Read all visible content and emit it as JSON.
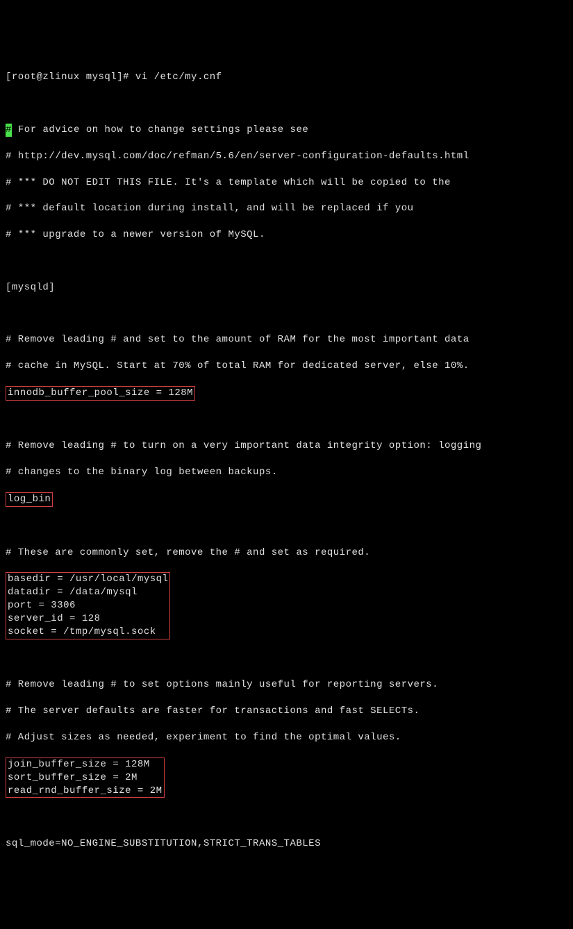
{
  "prompt": "[root@zlinux mysql]# vi /etc/my.cnf",
  "cursor_char": "#",
  "first_line_rest": " For advice on how to change settings please see",
  "comment_url": "# http://dev.mysql.com/doc/refman/5.6/en/server-configuration-defaults.html",
  "comment_edit1": "# *** DO NOT EDIT THIS FILE. It's a template which will be copied to the",
  "comment_edit2": "# *** default location during install, and will be replaced if you",
  "comment_edit3": "# *** upgrade to a newer version of MySQL.",
  "section_mysqld": "[mysqld]",
  "comment_ram1": "# Remove leading # and set to the amount of RAM for the most important data",
  "comment_ram2": "# cache in MySQL. Start at 70% of total RAM for dedicated server, else 10%.",
  "innodb_line": "innodb_buffer_pool_size = 128M",
  "comment_log1": "# Remove leading # to turn on a very important data integrity option: logging",
  "comment_log2": "# changes to the binary log between backups.",
  "log_bin_line": "log_bin",
  "comment_common": "# These are commonly set, remove the # and set as required.",
  "basedir_line": "basedir = /usr/local/mysql",
  "datadir_line": "datadir = /data/mysql",
  "port_line": "port = 3306",
  "server_id_line": "server_id = 128",
  "socket_line": "socket = /tmp/mysql.sock",
  "comment_report1": "# Remove leading # to set options mainly useful for reporting servers.",
  "comment_report2": "# The server defaults are faster for transactions and fast SELECTs.",
  "comment_report3": "# Adjust sizes as needed, experiment to find the optimal values.",
  "join_buffer_line": "join_buffer_size = 128M",
  "sort_buffer_line": "sort_buffer_size = 2M",
  "read_rnd_line": "read_rnd_buffer_size = 2M",
  "sql_mode_line": "sql_mode=NO_ENGINE_SUBSTITUTION,STRICT_TRANS_TABLES"
}
